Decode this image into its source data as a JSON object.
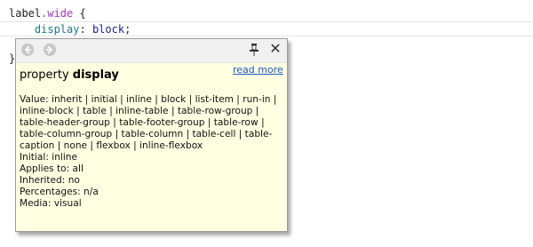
{
  "editor": {
    "line1": {
      "selector_tag": "label",
      "selector_class": ".wide",
      "brace_open": " {"
    },
    "line2": {
      "indent": "    ",
      "property": "display",
      "colon": ": ",
      "value": "block",
      "semicolon": ";"
    },
    "line3": {
      "brace_close": "}"
    }
  },
  "popup": {
    "nav_back_icon": "arrow-left-icon",
    "nav_forward_icon": "arrow-right-icon",
    "pin_icon": "pin-icon",
    "close_icon": "close-icon",
    "close_glyph": "✕",
    "title_prefix": "property ",
    "title_name": "display",
    "read_more_label": "read more",
    "value_line": "Value: inherit | initial | inline | block | list-item | run-in | inline-block | table | inline-table | table-row-group | table-header-group | table-footer-group | table-row | table-column-group | table-column | table-cell | table-caption | none | flexbox | inline-flexbox",
    "initial": "Initial: inline",
    "applies_to": "Applies to: all",
    "inherited": "Inherited: no",
    "percentages": "Percentages: n/a",
    "media": "Media: visual"
  },
  "colors": {
    "popup_background": "#ffffe1",
    "toolbar_background": "#f0f0f0",
    "link": "#1c56c9",
    "selector_class": "#9a3bb5",
    "property": "#1a7b82",
    "value": "#1d1d8f"
  }
}
